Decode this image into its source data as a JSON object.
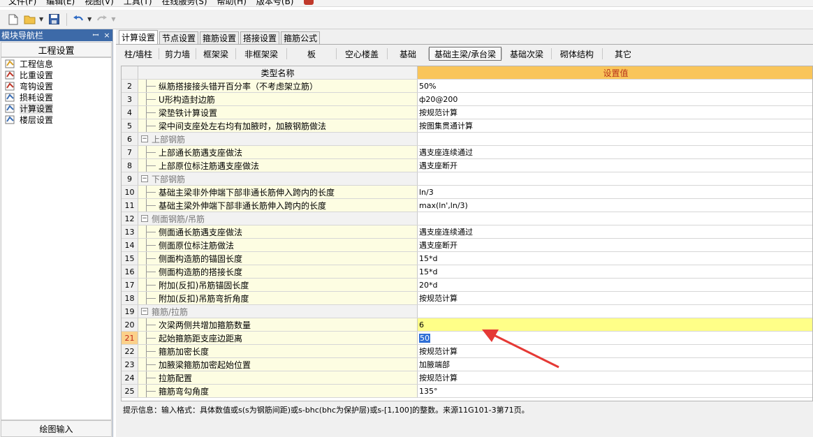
{
  "menu": {
    "items": [
      "文件(F)",
      "编辑(E)",
      "视图(V)",
      "工具(T)",
      "在线服务(S)",
      "帮助(H)",
      "版本号(B)"
    ]
  },
  "toolbar": {
    "icons": [
      "new-file-icon",
      "open-folder-icon",
      "save-icon",
      "undo-icon",
      "redo-icon"
    ]
  },
  "nav": {
    "title": "模块导航栏",
    "pin_glyph": "ꟷ",
    "close_glyph": "×",
    "header": "工程设置",
    "items": [
      {
        "label": "工程信息",
        "icon": "project-info-icon"
      },
      {
        "label": "比重设置",
        "icon": "weight-settings-icon"
      },
      {
        "label": "弯钩设置",
        "icon": "hook-settings-icon"
      },
      {
        "label": "损耗设置",
        "icon": "loss-settings-icon"
      },
      {
        "label": "计算设置",
        "icon": "calc-settings-icon",
        "selected": true
      },
      {
        "label": "楼层设置",
        "icon": "floor-settings-icon"
      }
    ],
    "footer": "绘图输入"
  },
  "tabs": [
    "计算设置",
    "节点设置",
    "箍筋设置",
    "搭接设置",
    "箍筋公式"
  ],
  "active_tab": 0,
  "subtabs": [
    "柱/墙柱",
    "剪力墙",
    "框架梁",
    "非框架梁",
    "板",
    "空心楼盖",
    "基础",
    "基础主梁/承台梁",
    "基础次梁",
    "砌体结构",
    "其它"
  ],
  "active_subtab": 7,
  "grid": {
    "header_name": "类型名称",
    "header_value": "设置值",
    "rows": [
      {
        "num": "2",
        "name": "纵筋搭接接头错开百分率（不考虑架立筋）",
        "value": "50%"
      },
      {
        "num": "3",
        "name": "U形构造封边筋",
        "value": "ф20@200"
      },
      {
        "num": "4",
        "name": "梁垫铁计算设置",
        "value": "按规范计算"
      },
      {
        "num": "5",
        "name": "梁中间支座处左右均有加腋时，加腋钢筋做法",
        "value": "按图集贯通计算"
      },
      {
        "num": "6",
        "name": "上部钢筋",
        "value": "",
        "group": true
      },
      {
        "num": "7",
        "name": "上部通长筋遇支座做法",
        "value": "遇支座连续通过"
      },
      {
        "num": "8",
        "name": "上部原位标注筋遇支座做法",
        "value": "遇支座断开"
      },
      {
        "num": "9",
        "name": "下部钢筋",
        "value": "",
        "group": true
      },
      {
        "num": "10",
        "name": "基础主梁非外伸端下部非通长筋伸入跨内的长度",
        "value": "ln/3"
      },
      {
        "num": "11",
        "name": "基础主梁外伸端下部非通长筋伸入跨内的长度",
        "value": "max(ln',ln/3)"
      },
      {
        "num": "12",
        "name": "侧面钢筋/吊筋",
        "value": "",
        "group": true
      },
      {
        "num": "13",
        "name": "侧面通长筋遇支座做法",
        "value": "遇支座连续通过"
      },
      {
        "num": "14",
        "name": "侧面原位标注筋做法",
        "value": "遇支座断开"
      },
      {
        "num": "15",
        "name": "侧面构造筋的锚固长度",
        "value": "15*d"
      },
      {
        "num": "16",
        "name": "侧面构造筋的搭接长度",
        "value": "15*d"
      },
      {
        "num": "17",
        "name": "附加(反扣)吊筋锚固长度",
        "value": "20*d"
      },
      {
        "num": "18",
        "name": "附加(反扣)吊筋弯折角度",
        "value": "按规范计算"
      },
      {
        "num": "19",
        "name": "箍筋/拉筋",
        "value": "",
        "group": true
      },
      {
        "num": "20",
        "name": "次梁两侧共增加箍筋数量",
        "value": "6",
        "highlight": true
      },
      {
        "num": "21",
        "name": "起始箍筋距支座边距离",
        "value": "50",
        "current": true
      },
      {
        "num": "22",
        "name": "箍筋加密长度",
        "value": "按规范计算"
      },
      {
        "num": "23",
        "name": "加腋梁箍筋加密起始位置",
        "value": "加腋端部"
      },
      {
        "num": "24",
        "name": "拉筋配置",
        "value": "按规范计算"
      },
      {
        "num": "25",
        "name": "箍筋弯勾角度",
        "value": "135°"
      }
    ]
  },
  "hint": "提示信息：输入格式：具体数值或s(s为钢筋间距)或s-bhc(bhc为保护层)或s-[1,100]的整数。来源11G101-3第71页。",
  "colors": {
    "nav_title_bg": "#3d6aa8",
    "value_header_bg": "#f9c55a",
    "highlight_row": "#ffff88",
    "name_cell_bg": "#fdfde2",
    "arrow": "#e53935"
  }
}
